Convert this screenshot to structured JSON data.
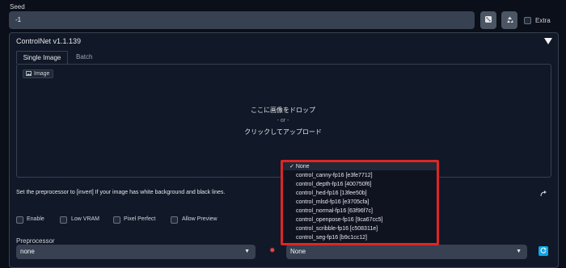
{
  "seed": {
    "label": "Seed",
    "value": "-1",
    "extra_label": "Extra"
  },
  "controlnet": {
    "title": "ControlNet v1.1.139",
    "tabs": [
      "Single Image",
      "Batch"
    ],
    "image_badge": "Image",
    "drop_line1": "ここに画像をドロップ",
    "drop_line2": "- or -",
    "drop_line3": "クリックしてアップロード",
    "hint": "Set the preprocessor to [invert] If your image has white background and black lines.",
    "checkboxes": [
      "Enable",
      "Low VRAM",
      "Pixel Perfect",
      "Allow Preview"
    ],
    "preprocessor_label": "Preprocessor",
    "preprocessor_value": "none",
    "model_value": "None"
  },
  "model_dropdown": {
    "options": [
      "None",
      "control_canny-fp16 [e3fe7712]",
      "control_depth-fp16 [400750f6]",
      "control_hed-fp16 [13fee50b]",
      "control_mlsd-fp16 [e3705cfa]",
      "control_normal-fp16 [63f96f7c]",
      "control_openpose-fp16 [9ca67cc5]",
      "control_scribble-fp16 [c508311e]",
      "control_seg-fp16 [b9c1cc12]"
    ],
    "selected_index": 0
  },
  "colors": {
    "background": "#0b0f19",
    "panel": "#111827",
    "input": "#374151",
    "highlight_box": "#dc2626",
    "refresh_button": "#0ea5e9"
  }
}
